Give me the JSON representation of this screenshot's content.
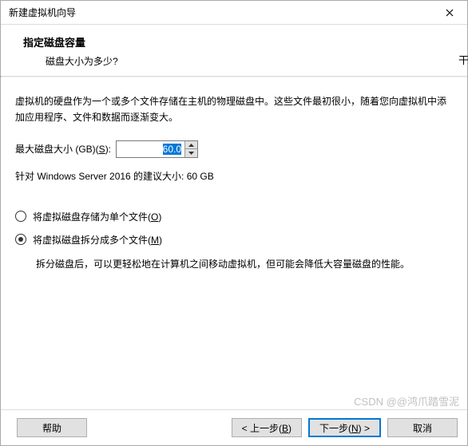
{
  "titlebar": {
    "title": "新建虚拟机向导"
  },
  "header": {
    "title": "指定磁盘容量",
    "subtitle": "磁盘大小为多少?"
  },
  "content": {
    "description": "虚拟机的硬盘作为一个或多个文件存储在主机的物理磁盘中。这些文件最初很小，随着您向虚拟机中添加应用程序、文件和数据而逐渐变大。",
    "size_label_pre": "最大磁盘大小 (GB)(",
    "size_label_key": "S",
    "size_label_post": "):",
    "size_value": "60.0",
    "recommend": "针对 Windows Server 2016 的建议大小: 60 GB",
    "radio1_pre": "将虚拟磁盘存储为单个文件(",
    "radio1_key": "O",
    "radio1_post": ")",
    "radio2_pre": "将虚拟磁盘拆分成多个文件(",
    "radio2_key": "M",
    "radio2_post": ")",
    "split_desc": "拆分磁盘后，可以更轻松地在计算机之间移动虚拟机，但可能会降低大容量磁盘的性能。"
  },
  "buttons": {
    "help": "帮助",
    "back_pre": "< 上一步(",
    "back_key": "B",
    "back_post": ")",
    "next_pre": "下一步(",
    "next_key": "N",
    "next_post": ") >",
    "cancel": "取消"
  },
  "watermark": "CSDN @@鸿爪踏雪泥",
  "side_char": "干"
}
